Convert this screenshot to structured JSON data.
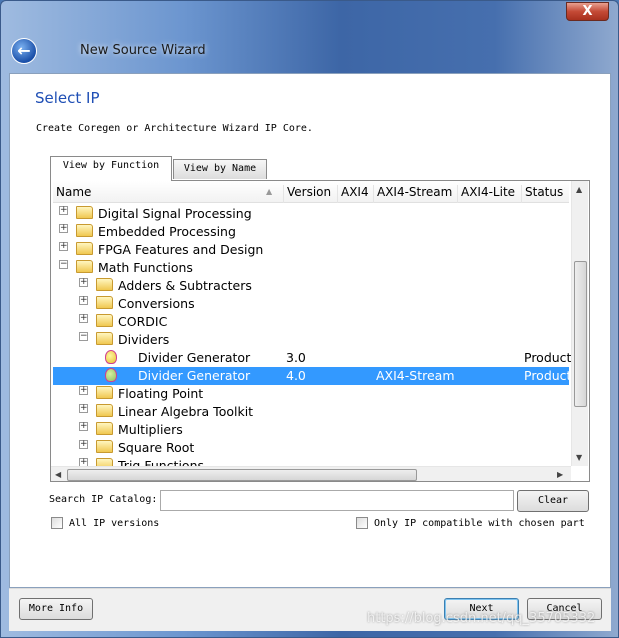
{
  "window": {
    "title": "New Source Wizard",
    "close_label": "X"
  },
  "page": {
    "heading": "Select IP",
    "description": "Create Coregen or Architecture Wizard IP Core."
  },
  "tabs": [
    {
      "label": "View by Function",
      "active": true
    },
    {
      "label": "View by Name",
      "active": false
    }
  ],
  "columns": [
    "Name",
    "Version",
    "AXI4",
    "AXI4-Stream",
    "AXI4-Lite",
    "Status"
  ],
  "rows": [
    {
      "name": "Digital Signal Processing",
      "level": 0,
      "type": "folder",
      "expanded": false
    },
    {
      "name": "Embedded Processing",
      "level": 0,
      "type": "folder",
      "expanded": false
    },
    {
      "name": "FPGA Features and Design",
      "level": 0,
      "type": "folder",
      "expanded": false
    },
    {
      "name": "Math Functions",
      "level": 0,
      "type": "folder",
      "expanded": true
    },
    {
      "name": "Adders & Subtracters",
      "level": 1,
      "type": "folder",
      "expanded": false
    },
    {
      "name": "Conversions",
      "level": 1,
      "type": "folder",
      "expanded": false
    },
    {
      "name": "CORDIC",
      "level": 1,
      "type": "folder",
      "expanded": false
    },
    {
      "name": "Dividers",
      "level": 1,
      "type": "folder",
      "expanded": true
    },
    {
      "name": "Divider Generator",
      "level": 2,
      "type": "ip",
      "version": "3.0",
      "axi4": "",
      "axi4stream": "",
      "axi4lite": "",
      "status": "Product"
    },
    {
      "name": "Divider Generator",
      "level": 2,
      "type": "ip",
      "version": "4.0",
      "axi4": "",
      "axi4stream": "AXI4-Stream",
      "axi4lite": "",
      "status": "Product",
      "selected": true
    },
    {
      "name": "Floating Point",
      "level": 1,
      "type": "folder",
      "expanded": false
    },
    {
      "name": "Linear Algebra Toolkit",
      "level": 1,
      "type": "folder",
      "expanded": false
    },
    {
      "name": "Multipliers",
      "level": 1,
      "type": "folder",
      "expanded": false
    },
    {
      "name": "Square Root",
      "level": 1,
      "type": "folder",
      "expanded": false
    },
    {
      "name": "Trig Functions",
      "level": 1,
      "type": "folder",
      "expanded": false
    }
  ],
  "search": {
    "label": "Search IP Catalog:",
    "value": "",
    "clear_label": "Clear"
  },
  "options": {
    "all_versions": {
      "label": "All IP versions",
      "checked": false
    },
    "compatible": {
      "label": "Only IP compatible with chosen part",
      "checked": false
    }
  },
  "footer": {
    "more_info": "More Info",
    "next": "Next",
    "cancel": "Cancel"
  },
  "watermark": "https://blog.csdn.net/qq_35705332",
  "colors": {
    "accent": "#1f4fb5",
    "selection": "#3399ff"
  }
}
